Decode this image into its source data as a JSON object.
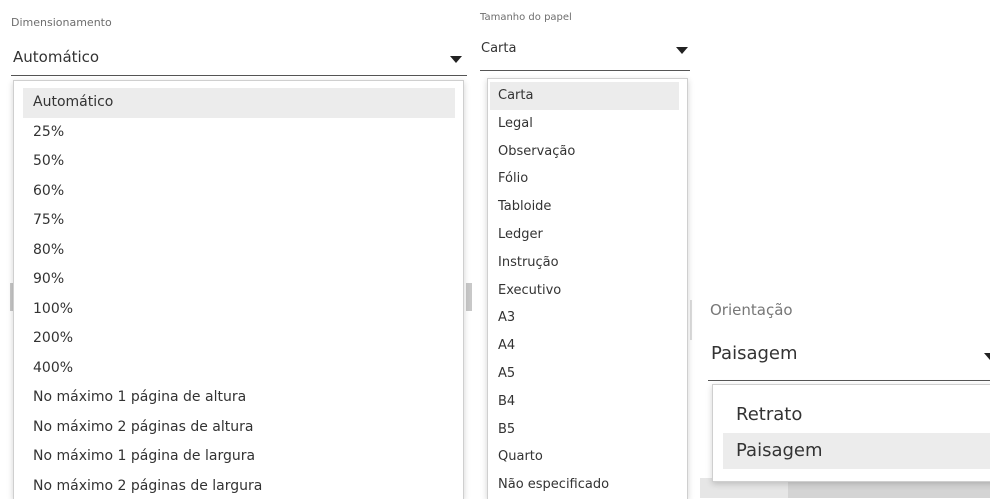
{
  "dimensionamento": {
    "caption": "Dimensionamento",
    "value": "Automático",
    "options": [
      "Automático",
      "25%",
      "50%",
      "60%",
      "75%",
      "80%",
      "90%",
      "100%",
      "200%",
      "400%",
      "No máximo 1 página de altura",
      "No máximo 2 páginas de altura",
      "No máximo 1 página de largura",
      "No máximo 2 páginas de largura"
    ],
    "selected_index": 0
  },
  "tamanho_papel": {
    "caption": "Tamanho do papel",
    "value": "Carta",
    "options": [
      "Carta",
      "Legal",
      "Observação",
      "Fólio",
      "Tabloide",
      "Ledger",
      "Instrução",
      "Executivo",
      "A3",
      "A4",
      "A5",
      "B4",
      "B5",
      "Quarto",
      "Não especificado"
    ],
    "selected_index": 0
  },
  "orientacao": {
    "caption": "Orientação",
    "value": "Paisagem",
    "options": [
      "Retrato",
      "Paisagem"
    ],
    "selected_index": 1
  },
  "colors": {
    "selected_bg": "#ececec",
    "caption": "#6e6e6e",
    "text": "#333333"
  }
}
